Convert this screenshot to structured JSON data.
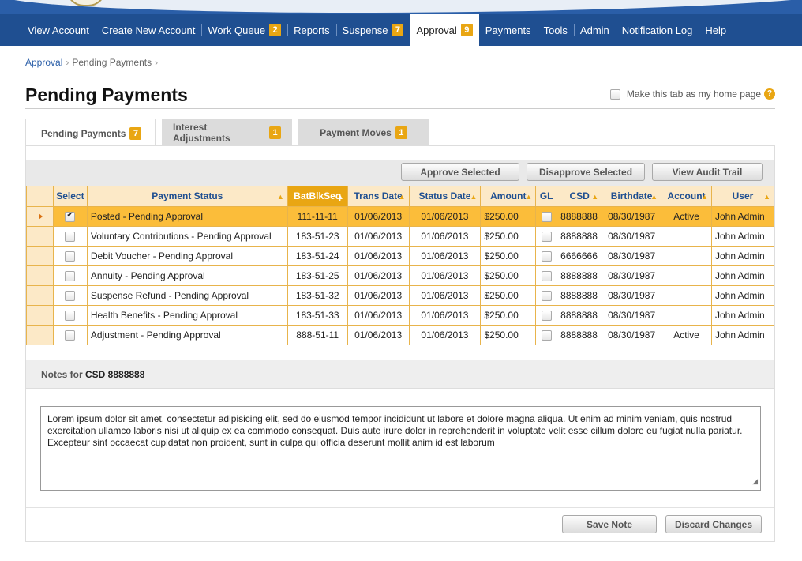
{
  "nav": {
    "items": [
      {
        "label": "View Account",
        "badge": ""
      },
      {
        "label": "Create New Account",
        "badge": ""
      },
      {
        "label": "Work Queue",
        "badge": "2"
      },
      {
        "label": "Reports",
        "badge": ""
      },
      {
        "label": "Suspense",
        "badge": "7"
      },
      {
        "label": "Approval",
        "badge": "9"
      },
      {
        "label": "Payments",
        "badge": ""
      },
      {
        "label": "Tools",
        "badge": ""
      },
      {
        "label": "Admin",
        "badge": ""
      },
      {
        "label": "Notification Log",
        "badge": ""
      },
      {
        "label": "Help",
        "badge": ""
      }
    ],
    "active": "Approval"
  },
  "breadcrumb": {
    "root": "Approval",
    "current": "Pending Payments"
  },
  "page": {
    "title": "Pending Payments",
    "homepage_label": "Make this tab as my home page",
    "help_glyph": "?"
  },
  "tabs": [
    {
      "label": "Pending Payments",
      "badge": "7"
    },
    {
      "label": "Interest Adjustments",
      "badge": "1"
    },
    {
      "label": "Payment Moves",
      "badge": "1"
    }
  ],
  "toolbar": {
    "approve_label": "Approve Selected",
    "disapprove_label": "Disapprove Selected",
    "audit_label": "View Audit Trail"
  },
  "table": {
    "headers": [
      "Select",
      "Payment Status",
      "BatBlkSeq",
      "Trans Date",
      "Status Date",
      "Amount",
      "GL",
      "CSD",
      "Birthdate",
      "Account",
      "User"
    ],
    "sorted_column": "BatBlkSeq",
    "rows": [
      {
        "selected": true,
        "status": "Posted - Pending Approval",
        "seq": "111-11-11",
        "trans": "01/06/2013",
        "statusDate": "01/06/2013",
        "amount": "$250.00",
        "csd": "8888888",
        "birth": "08/30/1987",
        "account": "Active",
        "user": "John Admin"
      },
      {
        "selected": false,
        "status": "Voluntary Contributions - Pending Approval",
        "seq": "183-51-23",
        "trans": "01/06/2013",
        "statusDate": "01/06/2013",
        "amount": "$250.00",
        "csd": "8888888",
        "birth": "08/30/1987",
        "account": "",
        "user": "John Admin"
      },
      {
        "selected": false,
        "status": "Debit Voucher - Pending Approval",
        "seq": "183-51-24",
        "trans": "01/06/2013",
        "statusDate": "01/06/2013",
        "amount": "$250.00",
        "csd": "6666666",
        "birth": "08/30/1987",
        "account": "",
        "user": "John Admin"
      },
      {
        "selected": false,
        "status": "Annuity - Pending Approval",
        "seq": "183-51-25",
        "trans": "01/06/2013",
        "statusDate": "01/06/2013",
        "amount": "$250.00",
        "csd": "8888888",
        "birth": "08/30/1987",
        "account": "",
        "user": "John Admin"
      },
      {
        "selected": false,
        "status": "Suspense Refund - Pending Approval",
        "seq": "183-51-32",
        "trans": "01/06/2013",
        "statusDate": "01/06/2013",
        "amount": "$250.00",
        "csd": "8888888",
        "birth": "08/30/1987",
        "account": "",
        "user": "John Admin"
      },
      {
        "selected": false,
        "status": "Health Benefits - Pending Approval",
        "seq": "183-51-33",
        "trans": "01/06/2013",
        "statusDate": "01/06/2013",
        "amount": "$250.00",
        "csd": "8888888",
        "birth": "08/30/1987",
        "account": "",
        "user": "John Admin"
      },
      {
        "selected": false,
        "status": "Adjustment - Pending Approval",
        "seq": "888-51-11",
        "trans": "01/06/2013",
        "statusDate": "01/06/2013",
        "amount": "$250.00",
        "csd": "8888888",
        "birth": "08/30/1987",
        "account": "Active",
        "user": "John Admin"
      }
    ]
  },
  "notes": {
    "label": "Notes for",
    "csd": "CSD 8888888",
    "text": "Lorem ipsum dolor sit amet, consectetur adipisicing elit, sed do eiusmod tempor incididunt ut labore et dolore magna aliqua. Ut enim ad minim veniam, quis nostrud exercitation ullamco laboris nisi ut aliquip ex ea commodo consequat. Duis aute irure dolor in reprehenderit in voluptate velit esse cillum dolore eu fugiat nulla pariatur. Excepteur sint occaecat cupidatat non proident, sunt in culpa qui officia deserunt mollit anim id est laborum",
    "save_label": "Save Note",
    "discard_label": "Discard Changes"
  },
  "colors": {
    "nav": "#1f4f91",
    "accent": "#e9a613",
    "selected_row": "#fbbd3a",
    "header_bg": "#fce9c7"
  }
}
